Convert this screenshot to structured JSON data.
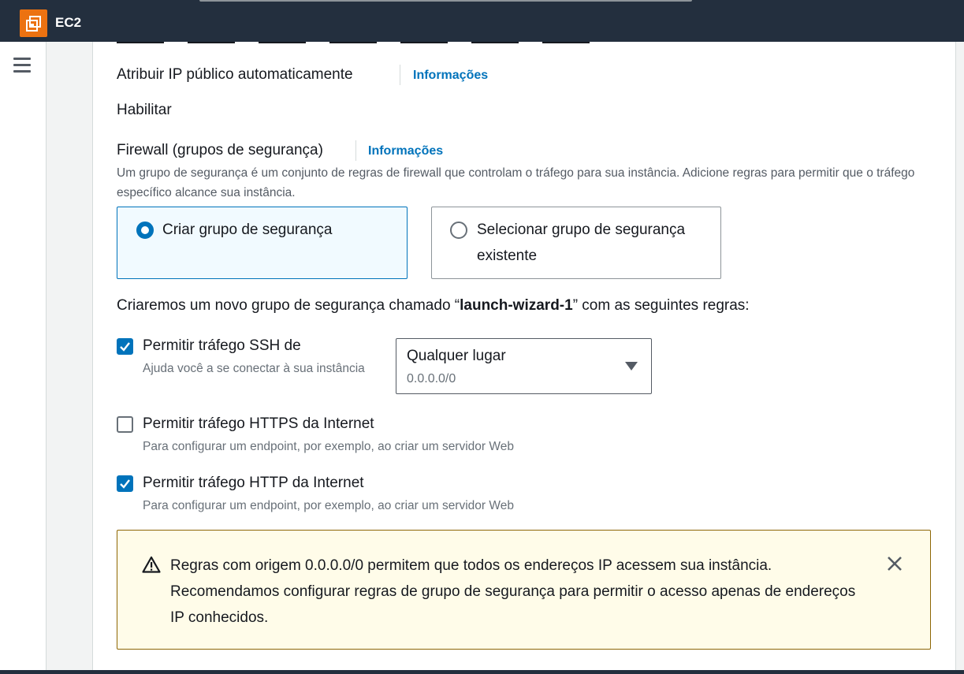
{
  "app": {
    "title": "EC2",
    "logo_icon": "ec2-service-icon"
  },
  "nav": {
    "menu_icon": "hamburger-menu-icon"
  },
  "public_ip": {
    "label": "Atribuir IP público automaticamente",
    "info_link": "Informações",
    "value": "Habilitar"
  },
  "firewall": {
    "label": "Firewall (grupos de segurança)",
    "info_link": "Informações",
    "description": "Um grupo de segurança é um conjunto de regras de firewall que controlam o tráfego para sua instância. Adicione regras para permitir que o tráfego específico alcance sua instância.",
    "options": [
      {
        "label": "Criar grupo de segurança",
        "selected": true
      },
      {
        "label": "Selecionar grupo de segurança existente",
        "selected": false
      }
    ],
    "new_group_prefix": "Criaremos um novo grupo de segurança chamado “",
    "new_group_name": "launch-wizard-1",
    "new_group_suffix": "” com as seguintes regras:"
  },
  "rules": {
    "ssh": {
      "label": "Permitir tráfego SSH de",
      "help": "Ajuda você a se conectar à sua instância",
      "checked": true,
      "source_value": "Qualquer lugar",
      "source_cidr": "0.0.0.0/0"
    },
    "https": {
      "label": "Permitir tráfego HTTPS da Internet",
      "help": "Para configurar um endpoint, por exemplo, ao criar um servidor Web",
      "checked": false
    },
    "http": {
      "label": "Permitir tráfego HTTP da Internet",
      "help": "Para configurar um endpoint, por exemplo, ao criar um servidor Web",
      "checked": true
    }
  },
  "warning": {
    "text": "Regras com origem 0.0.0.0/0 permitem que todos os endereços IP acessem sua instância. Recomendamos configurar regras de grupo de segurança para permitir o acesso apenas de endereços IP conhecidos.",
    "icon": "warning-triangle-icon"
  },
  "colors": {
    "accent": "#0073bb",
    "header": "#232f3e",
    "logo": "#ec7211",
    "warning_bg": "#fffce9"
  }
}
